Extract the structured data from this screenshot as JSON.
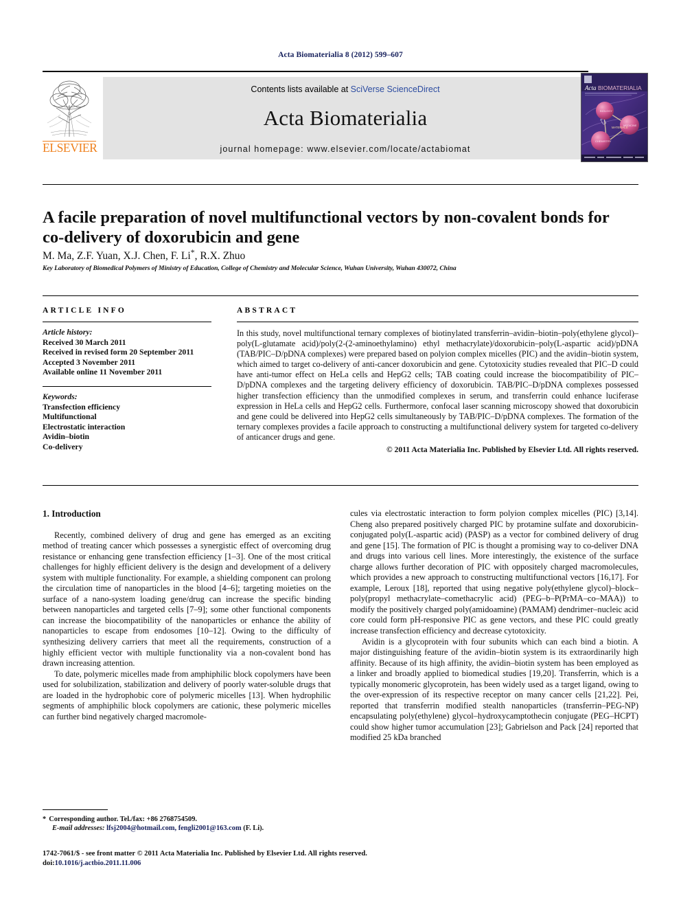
{
  "running_head": "Acta Biomaterialia 8 (2012) 599–607",
  "masthead": {
    "publisher_name": "ELSEVIER",
    "contents_prefix": "Contents lists available at ",
    "contents_link": "SciVerse ScienceDirect",
    "journal_name": "Acta Biomaterialia",
    "homepage": "journal homepage: www.elsevier.com/locate/actabiomat",
    "cover_title_italic": "Acta",
    "cover_title_rest": "BIOMATERIALIA"
  },
  "article": {
    "title": "A facile preparation of novel multifunctional vectors by non-covalent bonds for co-delivery of doxorubicin and gene",
    "authors": "M. Ma, Z.F. Yuan, X.J. Chen, F. Li",
    "authors_tail": ", R.X. Zhuo",
    "corresponding_marker": "*",
    "affiliation": "Key Laboratory of Biomedical Polymers of Ministry of Education, College of Chemistry and Molecular Science, Wuhan University, Wuhan 430072, China"
  },
  "article_info": {
    "heading": "ARTICLE INFO",
    "history_label": "Article history:",
    "history": [
      "Received 30 March 2011",
      "Received in revised form 20 September 2011",
      "Accepted 3 November 2011",
      "Available online 11 November 2011"
    ],
    "keywords_label": "Keywords:",
    "keywords": [
      "Transfection efficiency",
      "Multifunctional",
      "Electrostatic interaction",
      "Avidin–biotin",
      "Co-delivery"
    ]
  },
  "abstract": {
    "heading": "ABSTRACT",
    "text": "In this study, novel multifunctional ternary complexes of biotinylated transferrin–avidin–biotin–poly(ethylene glycol)–poly(L-glutamate acid)/poly(2-(2-aminoethylamino) ethyl methacrylate)/doxorubicin–poly(L-aspartic acid)/pDNA (TAB/PIC–D/pDNA complexes) were prepared based on polyion complex micelles (PIC) and the avidin–biotin system, which aimed to target co-delivery of anti-cancer doxorubicin and gene. Cytotoxicity studies revealed that PIC–D could have anti-tumor effect on HeLa cells and HepG2 cells; TAB coating could increase the biocompatibility of PIC–D/pDNA complexes and the targeting delivery efficiency of doxorubicin. TAB/PIC–D/pDNA complexes possessed higher transfection efficiency than the unmodified complexes in serum, and transferrin could enhance luciferase expression in HeLa cells and HepG2 cells. Furthermore, confocal laser scanning microscopy showed that doxorubicin and gene could be delivered into HepG2 cells simultaneously by TAB/PIC–D/pDNA complexes. The formation of the ternary complexes provides a facile approach to constructing a multifunctional delivery system for targeted co-delivery of anticancer drugs and gene.",
    "copyright": "© 2011 Acta Materialia Inc. Published by Elsevier Ltd. All rights reserved."
  },
  "sections": {
    "intro_heading": "1. Introduction",
    "left_paragraphs": [
      "Recently, combined delivery of drug and gene has emerged as an exciting method of treating cancer which possesses a synergistic effect of overcoming drug resistance or enhancing gene transfection efficiency [1–3]. One of the most critical challenges for highly efficient delivery is the design and development of a delivery system with multiple functionality. For example, a shielding component can prolong the circulation time of nanoparticles in the blood [4–6]; targeting moieties on the surface of a nano-system loading gene/drug can increase the specific binding between nanoparticles and targeted cells [7–9]; some other functional components can increase the biocompatibility of the nanoparticles or enhance the ability of nanoparticles to escape from endosomes [10–12]. Owing to the difficulty of synthesizing delivery carriers that meet all the requirements, construction of a highly efficient vector with multiple functionality via a non-covalent bond has drawn increasing attention.",
      "To date, polymeric micelles made from amphiphilic block copolymers have been used for solubilization, stabilization and delivery of poorly water-soluble drugs that are loaded in the hydrophobic core of polymeric micelles [13]. When hydrophilic segments of amphiphilic block copolymers are cationic, these polymeric micelles can further bind negatively charged macromole-"
    ],
    "right_paragraphs": [
      "cules via electrostatic interaction to form polyion complex micelles (PIC) [3,14]. Cheng also prepared positively charged PIC by protamine sulfate and doxorubicin-conjugated poly(L-aspartic acid) (PASP) as a vector for combined delivery of drug and gene [15]. The formation of PIC is thought a promising way to co-deliver DNA and drugs into various cell lines. More interestingly, the existence of the surface charge allows further decoration of PIC with oppositely charged macromolecules, which provides a new approach to constructing multifunctional vectors [16,17]. For example, Leroux [18], reported that using negative poly(ethylene glycol)–block–poly(propyl methacrylate–comethacrylic acid) (PEG–b–P(PrMA–co–MAA)) to modify the positively charged poly(amidoamine) (PAMAM) dendrimer–nucleic acid core could form pH-responsive PIC as gene vectors, and these PIC could greatly increase transfection efficiency and decrease cytotoxicity.",
      "Avidin is a glycoprotein with four subunits which can each bind a biotin. A major distinguishing feature of the avidin–biotin system is its extraordinarily high affinity. Because of its high affinity, the avidin–biotin system has been employed as a linker and broadly applied to biomedical studies [19,20]. Transferrin, which is a typically monomeric glycoprotein, has been widely used as a target ligand, owing to the over-expression of its respective receptor on many cancer cells [21,22]. Pei, reported that transferrin modified stealth nanoparticles (transferrin–PEG-NP) encapsulating poly(ethylene) glycol–hydroxycamptothecin conjugate (PEG–HCPT) could show higher tumor accumulation [23]; Gabrielson and Pack [24] reported that modified 25 kDa branched"
    ]
  },
  "footnotes": {
    "corresponding": "Corresponding author. Tel./fax: +86 2768754509.",
    "email_label": "E-mail addresses:",
    "emails": "lfsj2004@hotmail.com, fengli2001@163.com",
    "email_tail": "(F. Li)."
  },
  "page_footer": {
    "line1": "1742-7061/$ - see front matter © 2011 Acta Materialia Inc. Published by Elsevier Ltd. All rights reserved.",
    "doi_label": "doi:",
    "doi": "10.1016/j.actbio.2011.11.006"
  },
  "colors": {
    "link": "#2b4ba0",
    "reference": "#16205c",
    "elsevier_orange": "#ef7f1a",
    "band_gray": "#e3e3e3"
  }
}
